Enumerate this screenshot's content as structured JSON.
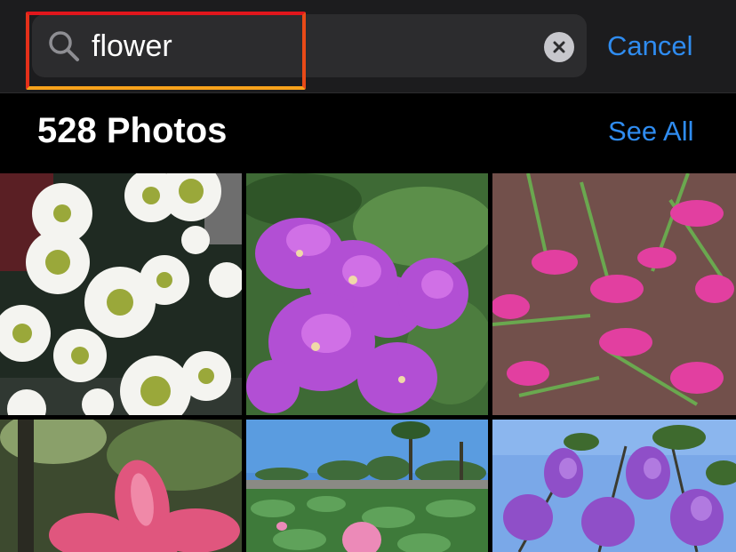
{
  "search": {
    "query": "flower",
    "cancel_label": "Cancel",
    "clear_icon": "clear-icon",
    "search_icon": "search-icon"
  },
  "results": {
    "title": "528 Photos",
    "see_all_label": "See All"
  },
  "photos": [
    {
      "name": "photo-white-daisies"
    },
    {
      "name": "photo-purple-crape-myrtle"
    },
    {
      "name": "photo-pink-lilies-on-stone"
    },
    {
      "name": "photo-pink-plumeria"
    },
    {
      "name": "photo-lotus-pond"
    },
    {
      "name": "photo-purple-blossoms-sky"
    }
  ],
  "colors": {
    "accent": "#2f8cf0",
    "highlight_top": "#e1161c",
    "highlight_bottom": "#f7a21b"
  }
}
